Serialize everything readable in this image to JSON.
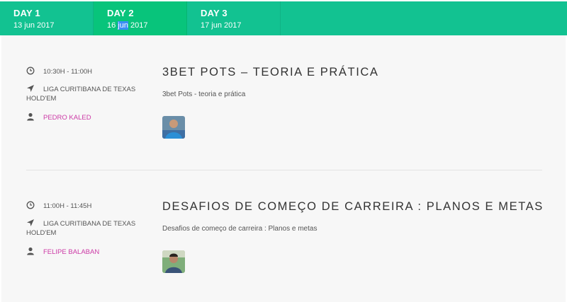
{
  "tabs": [
    {
      "day": "DAY 1",
      "date": "13 jun 2017"
    },
    {
      "day": "DAY 2",
      "date_pre": "16 ",
      "date_hl": "jun",
      "date_post": " 2017"
    },
    {
      "day": "DAY 3",
      "date": "17 jun 2017"
    }
  ],
  "sessions": [
    {
      "time": "10:30H - 11:00H",
      "location": "LIGA CURITIBANA DE TEXAS HOLD'EM",
      "speaker": "PEDRO KALED",
      "title": "3BET POTS – TEORIA E PRÁTICA",
      "description": "3bet Pots - teoria e prática"
    },
    {
      "time": "11:00H - 11:45H",
      "location": "LIGA CURITIBANA DE TEXAS HOLD'EM",
      "speaker": "FELIPE BALABAN",
      "title": "DESAFIOS DE COMEÇO DE CARREIRA : PLANOS E METAS",
      "description": "Desafios de começo de carreira : Planos e metas"
    }
  ],
  "colors": {
    "tab_bar": "#12c291",
    "tab_active": "#08c47b",
    "speaker": "#cc3aa6",
    "background": "#f7f7f7"
  },
  "icons": [
    "clock-icon",
    "location-arrow-icon",
    "user-icon"
  ]
}
